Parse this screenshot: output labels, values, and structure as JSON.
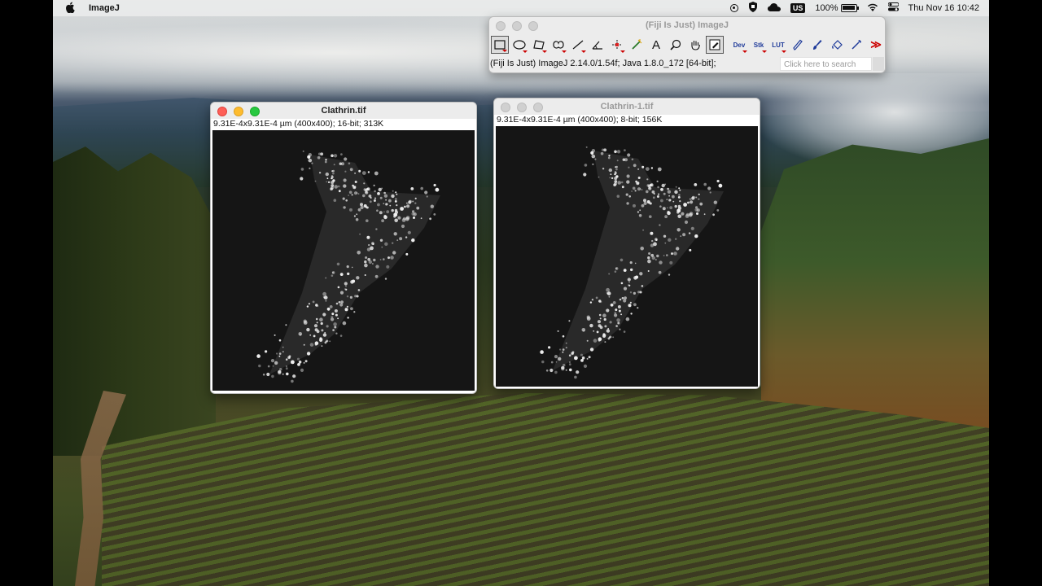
{
  "menubar": {
    "app_name": "ImageJ",
    "battery": "100%",
    "input_source": "US",
    "clock": "Thu Nov 16  10:42"
  },
  "imagej_toolbar": {
    "title": "(Fiji Is Just) ImageJ",
    "status": "(Fiji Is Just) ImageJ 2.14.0/1.54f; Java 1.8.0_172 [64-bit];",
    "search_placeholder": "Click here to search",
    "tools": [
      {
        "name": "rectangle",
        "label": ""
      },
      {
        "name": "oval",
        "label": ""
      },
      {
        "name": "polygon",
        "label": ""
      },
      {
        "name": "freehand",
        "label": ""
      },
      {
        "name": "line",
        "label": ""
      },
      {
        "name": "angle",
        "label": ""
      },
      {
        "name": "multipoint",
        "label": ""
      },
      {
        "name": "wand",
        "label": ""
      },
      {
        "name": "text",
        "label": "A"
      },
      {
        "name": "magnifier",
        "label": ""
      },
      {
        "name": "hand",
        "label": ""
      },
      {
        "name": "color-picker",
        "label": ""
      },
      {
        "name": "dev",
        "label": "Dev"
      },
      {
        "name": "stk",
        "label": "Stk"
      },
      {
        "name": "lut",
        "label": "LUT"
      },
      {
        "name": "pencil",
        "label": ""
      },
      {
        "name": "brush",
        "label": ""
      },
      {
        "name": "flood-fill",
        "label": ""
      },
      {
        "name": "dropper",
        "label": ""
      },
      {
        "name": "more",
        "label": "≫"
      }
    ]
  },
  "windows": [
    {
      "title": "Clathrin.tif",
      "info": "9.31E-4x9.31E-4 µm (400x400); 16-bit; 313K",
      "active": true
    },
    {
      "title": "Clathrin-1.tif",
      "info": "9.31E-4x9.31E-4 µm (400x400); 8-bit; 156K",
      "active": false
    }
  ],
  "colors": {
    "close": "#fe5f57",
    "minimize": "#febc2e",
    "zoom": "#28c840",
    "tool_icon": "#1f3b9a",
    "image_bg": "#151515"
  }
}
